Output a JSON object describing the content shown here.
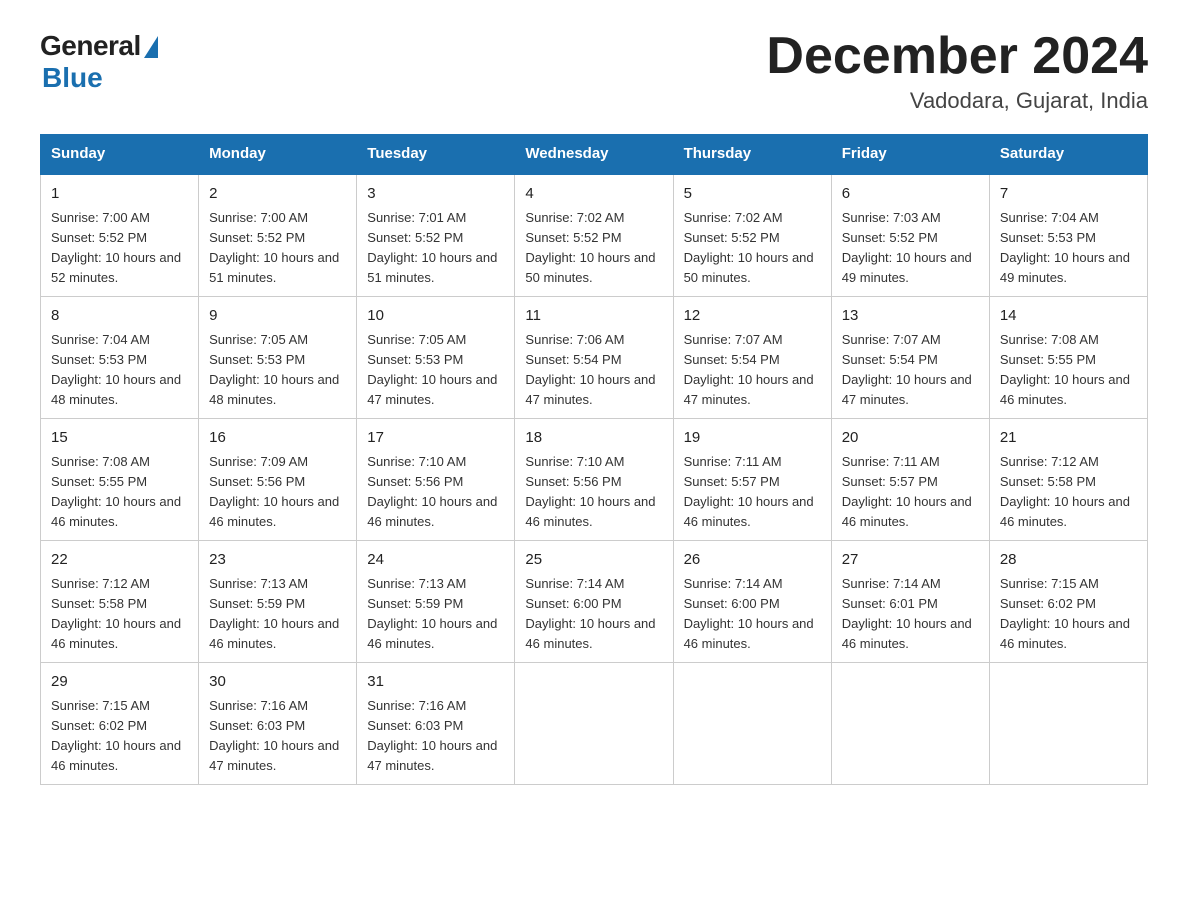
{
  "logo": {
    "general": "General",
    "blue": "Blue"
  },
  "header": {
    "title": "December 2024",
    "location": "Vadodara, Gujarat, India"
  },
  "days_of_week": [
    "Sunday",
    "Monday",
    "Tuesday",
    "Wednesday",
    "Thursday",
    "Friday",
    "Saturday"
  ],
  "weeks": [
    [
      {
        "day": "1",
        "sunrise": "Sunrise: 7:00 AM",
        "sunset": "Sunset: 5:52 PM",
        "daylight": "Daylight: 10 hours and 52 minutes."
      },
      {
        "day": "2",
        "sunrise": "Sunrise: 7:00 AM",
        "sunset": "Sunset: 5:52 PM",
        "daylight": "Daylight: 10 hours and 51 minutes."
      },
      {
        "day": "3",
        "sunrise": "Sunrise: 7:01 AM",
        "sunset": "Sunset: 5:52 PM",
        "daylight": "Daylight: 10 hours and 51 minutes."
      },
      {
        "day": "4",
        "sunrise": "Sunrise: 7:02 AM",
        "sunset": "Sunset: 5:52 PM",
        "daylight": "Daylight: 10 hours and 50 minutes."
      },
      {
        "day": "5",
        "sunrise": "Sunrise: 7:02 AM",
        "sunset": "Sunset: 5:52 PM",
        "daylight": "Daylight: 10 hours and 50 minutes."
      },
      {
        "day": "6",
        "sunrise": "Sunrise: 7:03 AM",
        "sunset": "Sunset: 5:52 PM",
        "daylight": "Daylight: 10 hours and 49 minutes."
      },
      {
        "day": "7",
        "sunrise": "Sunrise: 7:04 AM",
        "sunset": "Sunset: 5:53 PM",
        "daylight": "Daylight: 10 hours and 49 minutes."
      }
    ],
    [
      {
        "day": "8",
        "sunrise": "Sunrise: 7:04 AM",
        "sunset": "Sunset: 5:53 PM",
        "daylight": "Daylight: 10 hours and 48 minutes."
      },
      {
        "day": "9",
        "sunrise": "Sunrise: 7:05 AM",
        "sunset": "Sunset: 5:53 PM",
        "daylight": "Daylight: 10 hours and 48 minutes."
      },
      {
        "day": "10",
        "sunrise": "Sunrise: 7:05 AM",
        "sunset": "Sunset: 5:53 PM",
        "daylight": "Daylight: 10 hours and 47 minutes."
      },
      {
        "day": "11",
        "sunrise": "Sunrise: 7:06 AM",
        "sunset": "Sunset: 5:54 PM",
        "daylight": "Daylight: 10 hours and 47 minutes."
      },
      {
        "day": "12",
        "sunrise": "Sunrise: 7:07 AM",
        "sunset": "Sunset: 5:54 PM",
        "daylight": "Daylight: 10 hours and 47 minutes."
      },
      {
        "day": "13",
        "sunrise": "Sunrise: 7:07 AM",
        "sunset": "Sunset: 5:54 PM",
        "daylight": "Daylight: 10 hours and 47 minutes."
      },
      {
        "day": "14",
        "sunrise": "Sunrise: 7:08 AM",
        "sunset": "Sunset: 5:55 PM",
        "daylight": "Daylight: 10 hours and 46 minutes."
      }
    ],
    [
      {
        "day": "15",
        "sunrise": "Sunrise: 7:08 AM",
        "sunset": "Sunset: 5:55 PM",
        "daylight": "Daylight: 10 hours and 46 minutes."
      },
      {
        "day": "16",
        "sunrise": "Sunrise: 7:09 AM",
        "sunset": "Sunset: 5:56 PM",
        "daylight": "Daylight: 10 hours and 46 minutes."
      },
      {
        "day": "17",
        "sunrise": "Sunrise: 7:10 AM",
        "sunset": "Sunset: 5:56 PM",
        "daylight": "Daylight: 10 hours and 46 minutes."
      },
      {
        "day": "18",
        "sunrise": "Sunrise: 7:10 AM",
        "sunset": "Sunset: 5:56 PM",
        "daylight": "Daylight: 10 hours and 46 minutes."
      },
      {
        "day": "19",
        "sunrise": "Sunrise: 7:11 AM",
        "sunset": "Sunset: 5:57 PM",
        "daylight": "Daylight: 10 hours and 46 minutes."
      },
      {
        "day": "20",
        "sunrise": "Sunrise: 7:11 AM",
        "sunset": "Sunset: 5:57 PM",
        "daylight": "Daylight: 10 hours and 46 minutes."
      },
      {
        "day": "21",
        "sunrise": "Sunrise: 7:12 AM",
        "sunset": "Sunset: 5:58 PM",
        "daylight": "Daylight: 10 hours and 46 minutes."
      }
    ],
    [
      {
        "day": "22",
        "sunrise": "Sunrise: 7:12 AM",
        "sunset": "Sunset: 5:58 PM",
        "daylight": "Daylight: 10 hours and 46 minutes."
      },
      {
        "day": "23",
        "sunrise": "Sunrise: 7:13 AM",
        "sunset": "Sunset: 5:59 PM",
        "daylight": "Daylight: 10 hours and 46 minutes."
      },
      {
        "day": "24",
        "sunrise": "Sunrise: 7:13 AM",
        "sunset": "Sunset: 5:59 PM",
        "daylight": "Daylight: 10 hours and 46 minutes."
      },
      {
        "day": "25",
        "sunrise": "Sunrise: 7:14 AM",
        "sunset": "Sunset: 6:00 PM",
        "daylight": "Daylight: 10 hours and 46 minutes."
      },
      {
        "day": "26",
        "sunrise": "Sunrise: 7:14 AM",
        "sunset": "Sunset: 6:00 PM",
        "daylight": "Daylight: 10 hours and 46 minutes."
      },
      {
        "day": "27",
        "sunrise": "Sunrise: 7:14 AM",
        "sunset": "Sunset: 6:01 PM",
        "daylight": "Daylight: 10 hours and 46 minutes."
      },
      {
        "day": "28",
        "sunrise": "Sunrise: 7:15 AM",
        "sunset": "Sunset: 6:02 PM",
        "daylight": "Daylight: 10 hours and 46 minutes."
      }
    ],
    [
      {
        "day": "29",
        "sunrise": "Sunrise: 7:15 AM",
        "sunset": "Sunset: 6:02 PM",
        "daylight": "Daylight: 10 hours and 46 minutes."
      },
      {
        "day": "30",
        "sunrise": "Sunrise: 7:16 AM",
        "sunset": "Sunset: 6:03 PM",
        "daylight": "Daylight: 10 hours and 47 minutes."
      },
      {
        "day": "31",
        "sunrise": "Sunrise: 7:16 AM",
        "sunset": "Sunset: 6:03 PM",
        "daylight": "Daylight: 10 hours and 47 minutes."
      },
      null,
      null,
      null,
      null
    ]
  ]
}
